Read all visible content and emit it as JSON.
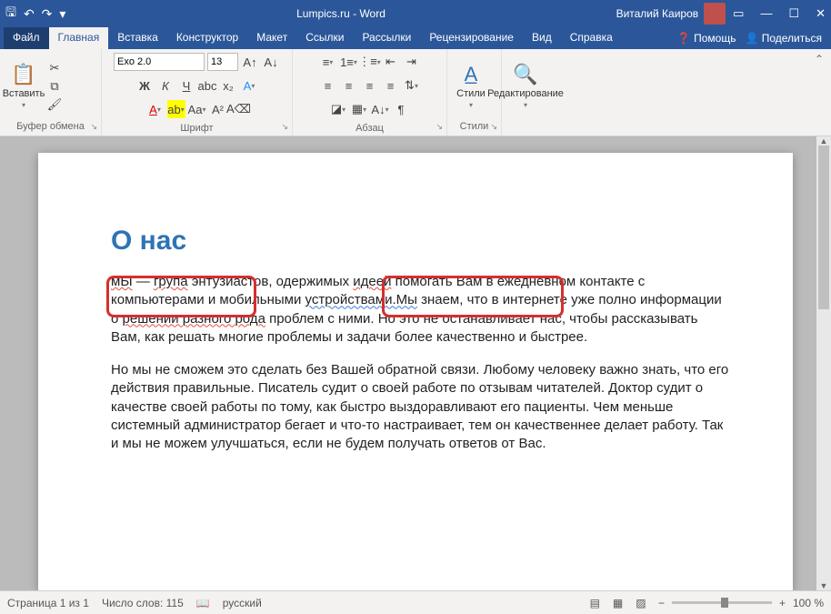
{
  "titlebar": {
    "title": "Lumpics.ru - Word",
    "username": "Виталий Каиров"
  },
  "tabs": {
    "file": "Файл",
    "home": "Главная",
    "insert": "Вставка",
    "design": "Конструктор",
    "layout": "Макет",
    "references": "Ссылки",
    "mailings": "Рассылки",
    "review": "Рецензирование",
    "view": "Вид",
    "help": "Справка",
    "tellme": "Помощь",
    "share": "Поделиться"
  },
  "ribbon": {
    "clipboard": {
      "paste": "Вставить",
      "label": "Буфер обмена"
    },
    "font": {
      "family": "Exo 2.0",
      "size": "13",
      "label": "Шрифт"
    },
    "paragraph": {
      "label": "Абзац"
    },
    "styles": {
      "btn": "Стили",
      "label": "Стили"
    },
    "editing": {
      "btn": "Редактирование"
    }
  },
  "doc": {
    "heading": "О нас",
    "p1_a": "мЫ",
    "p1_b": " — ",
    "p1_c": "група",
    "p1_d": " энтузиастов, одержимых ",
    "p1_e": "идеей",
    "p1_f": " помогать Вам в ежедневном контакте с компьютерами и мобильными ",
    "p1_g": "устройствами.Мы",
    "p1_h": " знаем, что в интернете уже полно информации о ",
    "p1_i": "решении разного рода",
    "p1_j": " проблем с ними. Но это не останавливает нас, чтобы рассказывать Вам, как решать многие проблемы и задачи более качественно и быстрее.",
    "p2": "Но мы не сможем это сделать без Вашей обратной связи. Любому человеку важно знать, что его действия правильные. Писатель судит о своей работе по отзывам читателей. Доктор судит о качестве своей работы по тому, как быстро выздоравливают его пациенты. Чем меньше системный администратор бегает и что-то настраивает, тем он качественнее делает работу. Так и мы не можем улучшаться, если не будем получать ответов от Вас."
  },
  "status": {
    "page": "Страница 1 из 1",
    "words": "Число слов: 115",
    "lang": "русский",
    "zoom": "100 %"
  }
}
